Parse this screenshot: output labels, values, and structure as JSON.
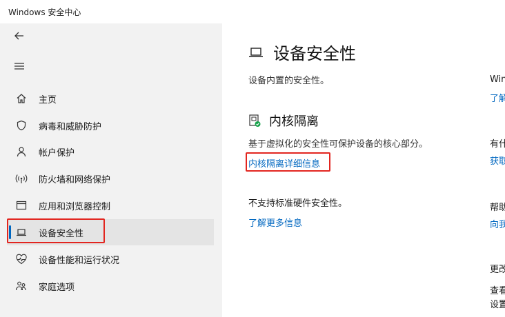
{
  "window": {
    "title": "Windows 安全中心"
  },
  "sidebar": {
    "items": [
      {
        "label": "主页",
        "icon": "home-icon"
      },
      {
        "label": "病毒和威胁防护",
        "icon": "shield-icon"
      },
      {
        "label": "帐户保护",
        "icon": "person-icon"
      },
      {
        "label": "防火墙和网络保护",
        "icon": "wifi-signal-icon"
      },
      {
        "label": "应用和浏览器控制",
        "icon": "app-window-icon"
      },
      {
        "label": "设备安全性",
        "icon": "laptop-icon",
        "selected": true
      },
      {
        "label": "设备性能和运行状况",
        "icon": "heart-icon"
      },
      {
        "label": "家庭选项",
        "icon": "family-icon"
      }
    ]
  },
  "main": {
    "title": "设备安全性",
    "subtitle": "设备内置的安全性。",
    "core_isolation": {
      "title": "内核隔离",
      "description": "基于虚拟化的安全性可保护设备的核心部分。",
      "link": "内核隔离详细信息"
    },
    "hardware": {
      "text": "不支持标准硬件安全性。",
      "link": "了解更多信息"
    }
  },
  "right_column": [
    {
      "text": "Win",
      "type": "text"
    },
    {
      "text": "了解",
      "type": "link"
    },
    {
      "text": "有什",
      "type": "text"
    },
    {
      "text": "获取",
      "type": "link"
    },
    {
      "text": "帮助",
      "type": "text"
    },
    {
      "text": "向我",
      "type": "link"
    },
    {
      "text": "更改",
      "type": "text"
    },
    {
      "text": "查看",
      "type": "text"
    },
    {
      "text": "设置",
      "type": "text"
    }
  ],
  "colors": {
    "accent": "#0067c0",
    "annotation": "#e2251f",
    "sidebar_bg": "#f2f2f2"
  }
}
